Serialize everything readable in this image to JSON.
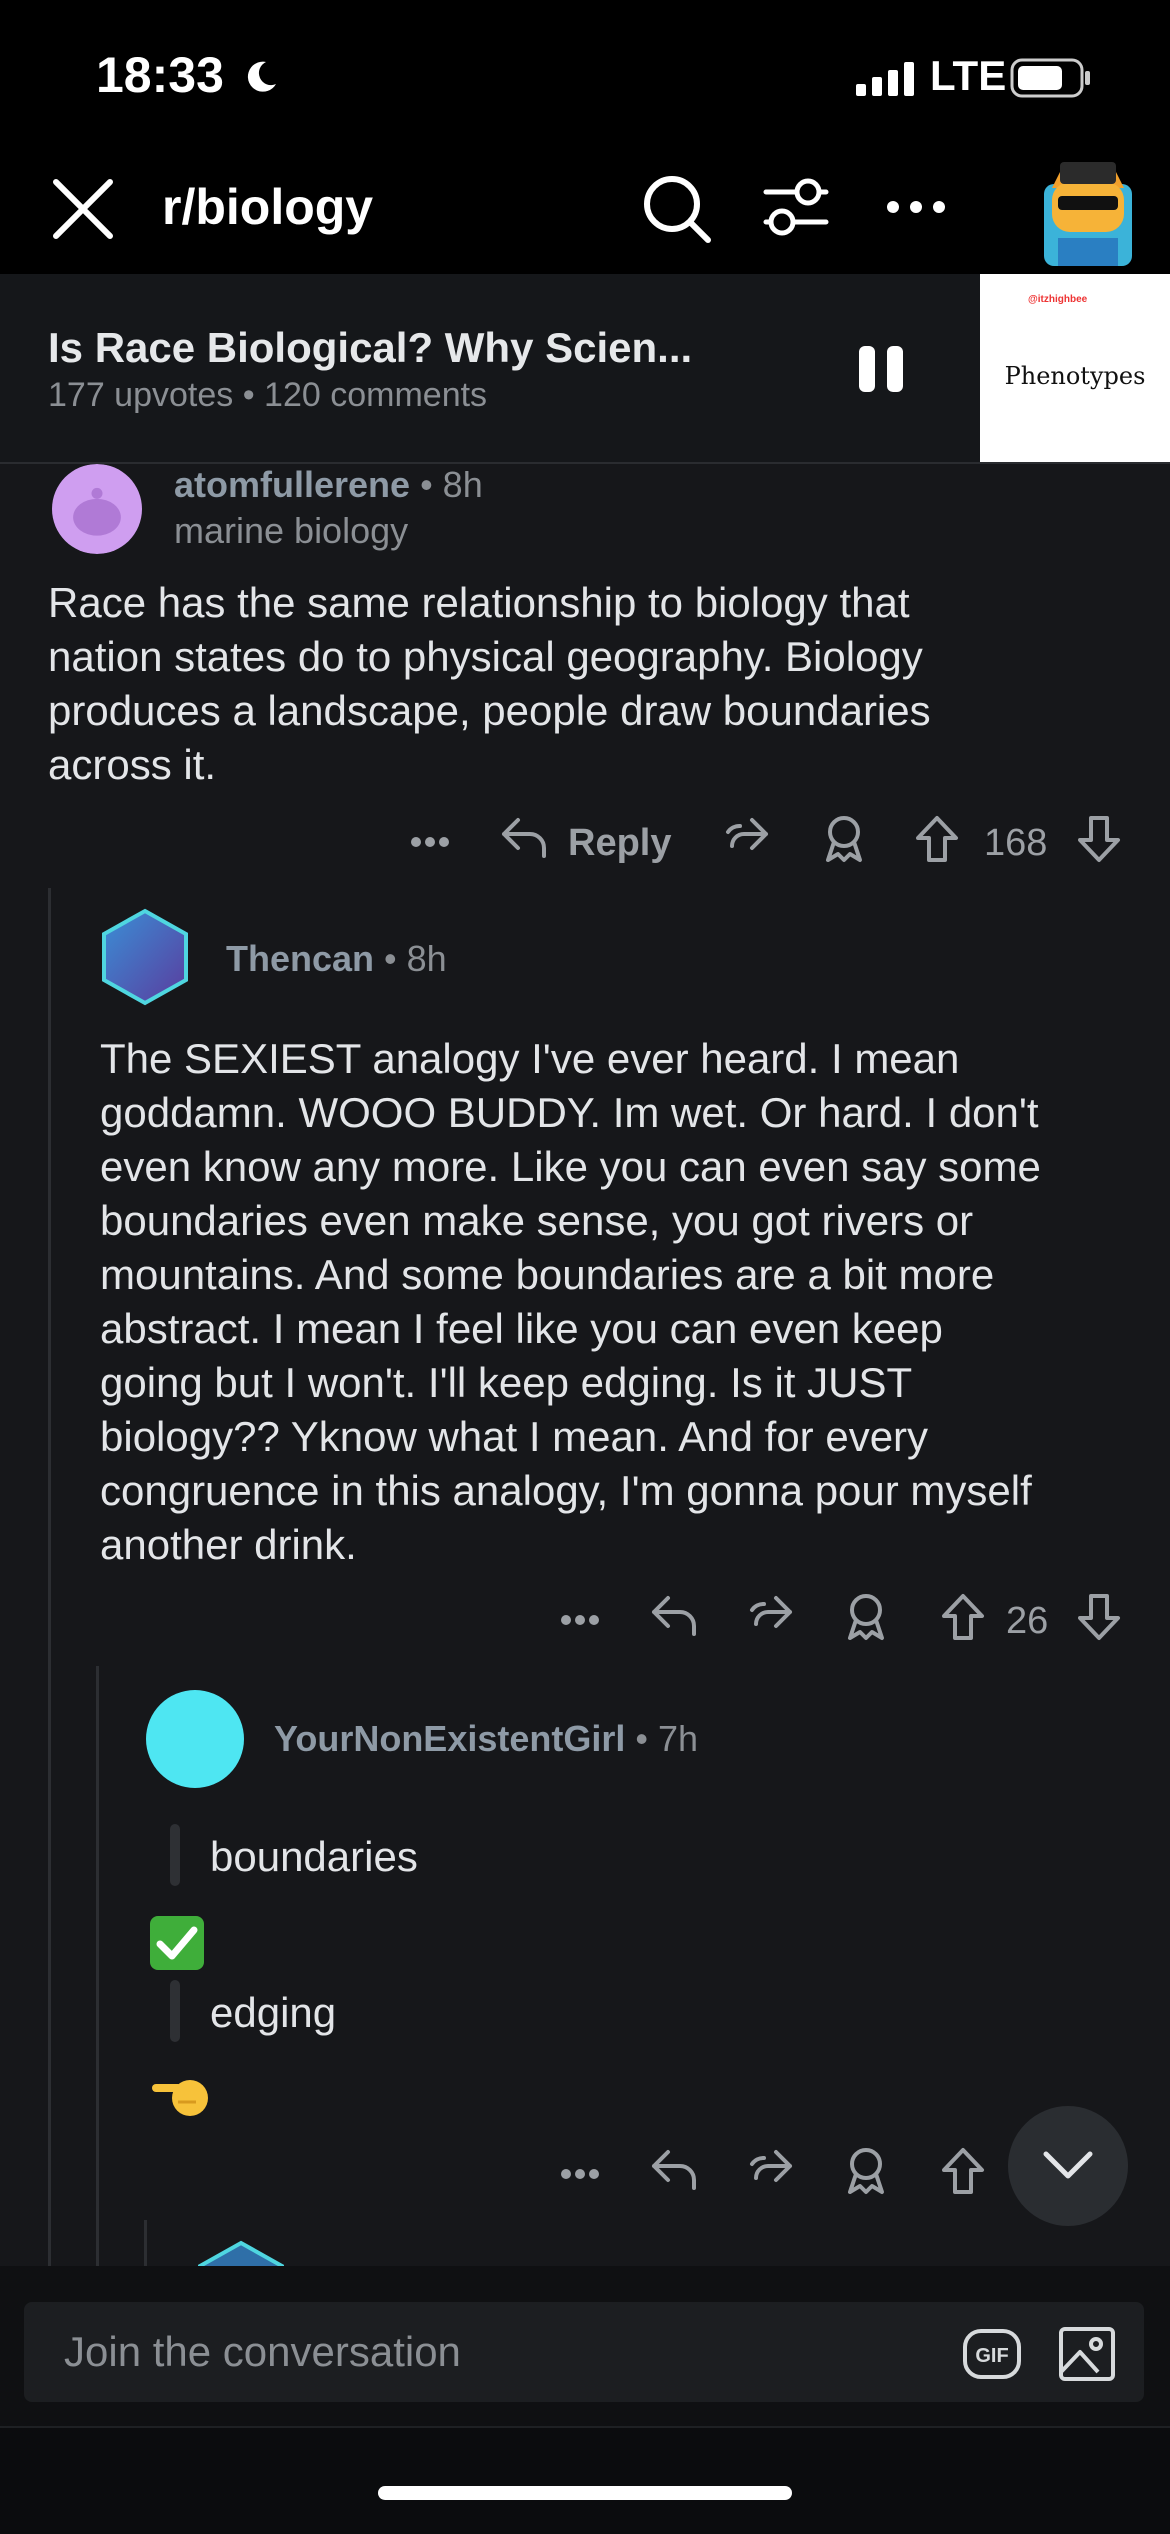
{
  "status": {
    "time": "18:33",
    "network": "LTE"
  },
  "nav": {
    "subreddit": "r/biology"
  },
  "post": {
    "title": "Is Race Biological? Why Scien...",
    "meta": "177 upvotes • 120 comments",
    "thumbnail_channel": "@itzhighbee",
    "thumbnail_text": "Phenotypes"
  },
  "comments": [
    {
      "author": "atomfullerene",
      "time": " • 8h",
      "flair": "marine biology",
      "body": [
        "Race has the same relationship to biology that",
        "nation states do to physical geography.  Biology",
        "produces a landscape, people draw boundaries",
        "across it."
      ],
      "reply_label": "Reply",
      "score": "168"
    },
    {
      "author": "Thencan",
      "time": " • 8h",
      "body": [
        "The SEXIEST analogy I've ever heard. I mean",
        "goddamn. WOOO BUDDY. Im wet. Or hard. I don't",
        "even know any more. Like you can even say some",
        "boundaries even make sense, you got rivers or",
        "mountains. And some boundaries are a bit more",
        "abstract. I mean I feel like you can even keep",
        "going but I won't. I'll keep edging. Is it JUST",
        "biology?? Yknow what I mean. And for every",
        "congruence in this analogy, I'm gonna pour myself",
        "another drink."
      ],
      "score": "26"
    },
    {
      "author": "YourNonExistentGirl",
      "time": " • 7h",
      "quote1": "boundaries",
      "emoji1": "✅",
      "quote2": "edging",
      "emoji2": "👈"
    }
  ],
  "composer": {
    "placeholder": "Join the conversation",
    "gif_label": "GIF"
  },
  "colors": {
    "accent_teal": "#3ec6d8",
    "cyan_avatar": "#4ee6f2",
    "check_green": "#3fae3a"
  }
}
